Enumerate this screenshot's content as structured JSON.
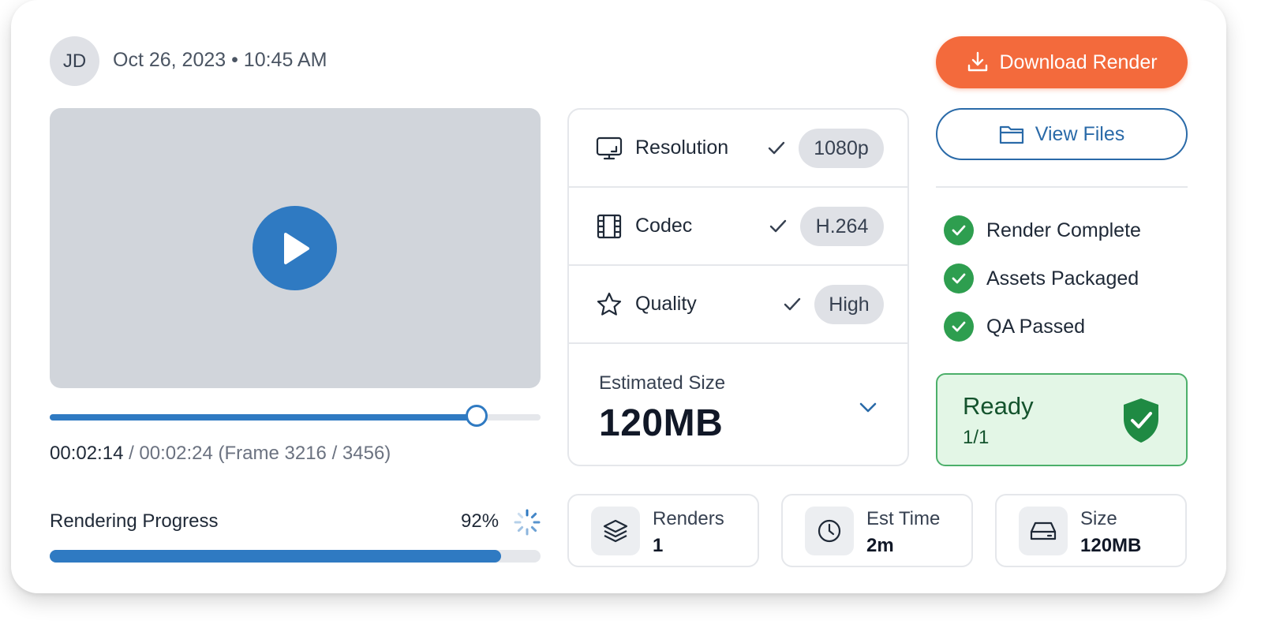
{
  "header": {
    "avatar_initials": "JD",
    "timestamp": "Oct 26, 2023 • 10:45 AM"
  },
  "player": {
    "current_time": "00:02:14",
    "time_suffix": " / 00:02:24 (Frame 3216 / 3456)",
    "scrub_progress_fraction": 0.87
  },
  "render_progress": {
    "label": "Rendering Progress",
    "percent_text": "92%",
    "percent": 92
  },
  "specs": [
    {
      "icon": "monitor-icon",
      "label": "Resolution",
      "value": "1080p"
    },
    {
      "icon": "film-icon",
      "label": "Codec",
      "value": "H.264"
    },
    {
      "icon": "star-icon",
      "label": "Quality",
      "value": "High"
    }
  ],
  "estimate": {
    "label": "Estimated Size",
    "value": "120MB"
  },
  "actions": {
    "download_label": "Download Render",
    "files_label": "View Files"
  },
  "checklist": [
    {
      "label": "Render Complete"
    },
    {
      "label": "Assets Packaged"
    },
    {
      "label": "QA Passed"
    }
  ],
  "status": {
    "title": "Ready",
    "subtitle": "1/1"
  },
  "stats": [
    {
      "icon": "layers-icon",
      "label": "Renders",
      "value": "1"
    },
    {
      "icon": "clock-icon",
      "label": "Est Time",
      "value": "2m"
    },
    {
      "icon": "hard-drive-icon",
      "label": "Size",
      "value": "120MB"
    }
  ],
  "colors": {
    "accent_blue": "#2f7ac2",
    "download_orange": "#f36a3c",
    "success_green": "#2e9e4f",
    "ready_bg": "#e3f6e6"
  }
}
